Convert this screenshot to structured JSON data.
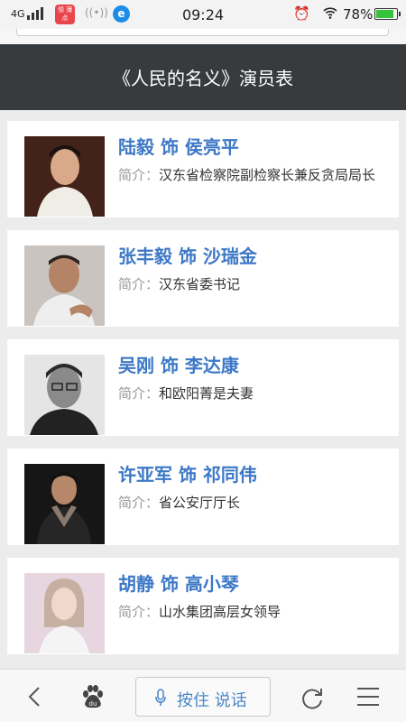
{
  "status_bar": {
    "network": "4G",
    "app_badge": "领 薄点",
    "time": "09:24",
    "battery": "78%",
    "battery_level": 0.78
  },
  "header": {
    "title": "《人民的名义》演员表"
  },
  "cast": [
    {
      "name": "陆毅 饰 侯亮平",
      "desc_label": "简介：",
      "desc": "汉东省检察院副检察长兼反贪局局长",
      "photo_tone": "#b07050"
    },
    {
      "name": "张丰毅 饰 沙瑞金",
      "desc_label": "简介：",
      "desc": "汉东省委书记",
      "photo_tone": "#8a7868"
    },
    {
      "name": "吴刚 饰 李达康",
      "desc_label": "简介：",
      "desc": "和欧阳菁是夫妻",
      "photo_tone": "#666666"
    },
    {
      "name": "许亚军 饰 祁同伟",
      "desc_label": "简介：",
      "desc": "省公安厅厅长",
      "photo_tone": "#3a3a3a"
    },
    {
      "name": "胡静 饰 高小琴",
      "desc_label": "简介：",
      "desc": "山水集团高层女领导",
      "photo_tone": "#d9b7c4"
    }
  ],
  "bottom_bar": {
    "voice_label": "按住 说话"
  },
  "colors": {
    "title_bar": "#373b3e",
    "link_blue": "#3c78c6",
    "background": "#ececec"
  }
}
